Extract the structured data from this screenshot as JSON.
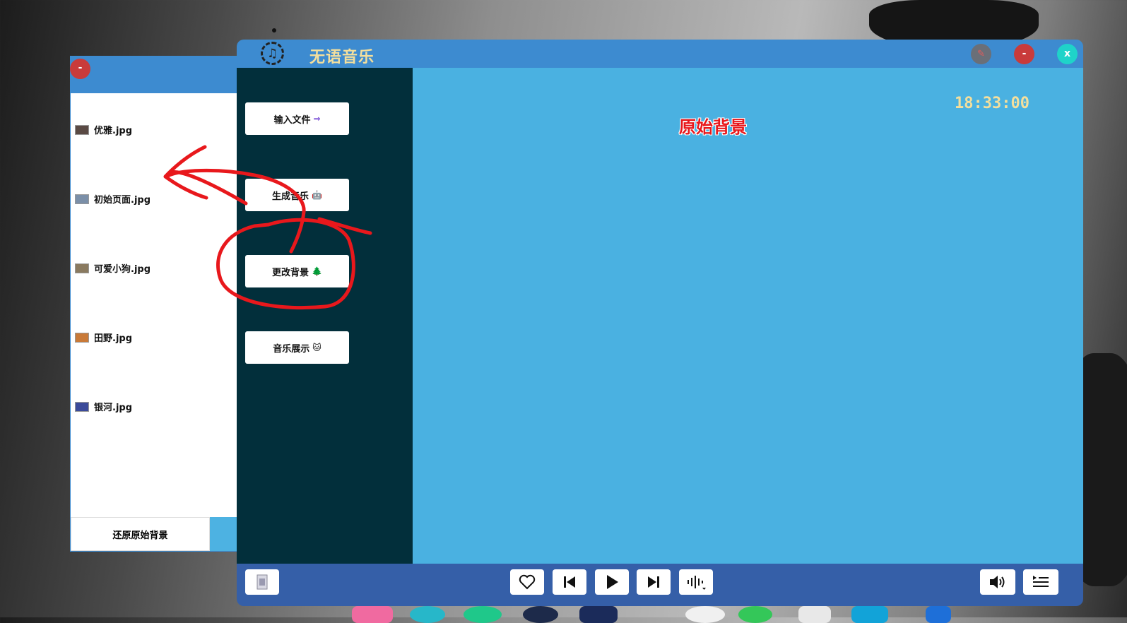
{
  "app": {
    "title": "无语音乐",
    "logo_icon": "music-note-icon"
  },
  "titlebar": {
    "pin_icon": "pin-icon",
    "minimize_label": "-",
    "close_label": "x"
  },
  "sidebar": {
    "items": [
      {
        "label": "输入文件",
        "icon": "arrow-right-icon",
        "icon_glyph": "⇒"
      },
      {
        "label": "生成音乐",
        "icon": "robot-icon",
        "icon_glyph": "🤖"
      },
      {
        "label": "更改背景",
        "icon": "tree-icon",
        "icon_glyph": "🌲"
      },
      {
        "label": "音乐展示",
        "icon": "cat-icon",
        "icon_glyph": "🐱"
      }
    ]
  },
  "content": {
    "clock": "18:33:00",
    "background_label": "原始背景"
  },
  "background_panel": {
    "minimize_label": "-",
    "items": [
      {
        "name": "优雅.jpg",
        "thumb_color": "#5a4a44"
      },
      {
        "name": "初始页面.jpg",
        "thumb_color": "#7b8fa8"
      },
      {
        "name": "可爱小狗.jpg",
        "thumb_color": "#8a7a60"
      },
      {
        "name": "田野.jpg",
        "thumb_color": "#c97a38"
      },
      {
        "name": "银河.jpg",
        "thumb_color": "#3b4a9a"
      }
    ],
    "restore_label": "还原原始背景"
  },
  "player": {
    "controls": [
      "like-icon",
      "previous-icon",
      "play-icon",
      "next-icon",
      "equalizer-icon"
    ],
    "volume_icon": "volume-icon",
    "playlist_icon": "playlist-icon",
    "cover_icon": "album-cover-icon"
  },
  "colors": {
    "titlebar": "#3d8bd0",
    "sidebar": "#022f3b",
    "content": "#4ab1e1",
    "player": "#355fa8",
    "title_text": "#f3df9d",
    "annotation": "#e8181c"
  }
}
